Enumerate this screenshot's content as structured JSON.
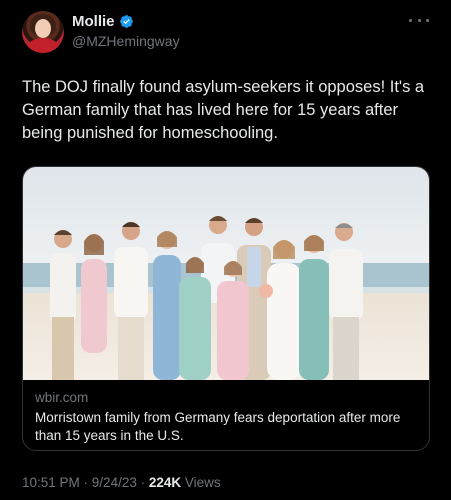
{
  "author": {
    "display_name": "Mollie",
    "handle": "@MZHemingway",
    "verified": true
  },
  "tweet": {
    "text": "The DOJ finally found asylum-seekers it opposes! It's a German family that has lived here for 15 years after being punished for homeschooling."
  },
  "card": {
    "domain": "wbir.com",
    "title": "Morristown family from Germany fears deportation after more than 15 years in the U.S."
  },
  "meta": {
    "time": "10:51 PM",
    "separator1": " · ",
    "date": "9/24/23",
    "separator2": " · ",
    "views_count": "224K",
    "views_label": " Views"
  },
  "colors": {
    "background": "#000000",
    "primary_text": "#e7e9ea",
    "secondary_text": "#71767b",
    "verified_badge": "#1d9bf0",
    "card_border": "#2f3336"
  },
  "icons": {
    "verified": "verified-badge-icon",
    "more": "more-dots-icon"
  }
}
